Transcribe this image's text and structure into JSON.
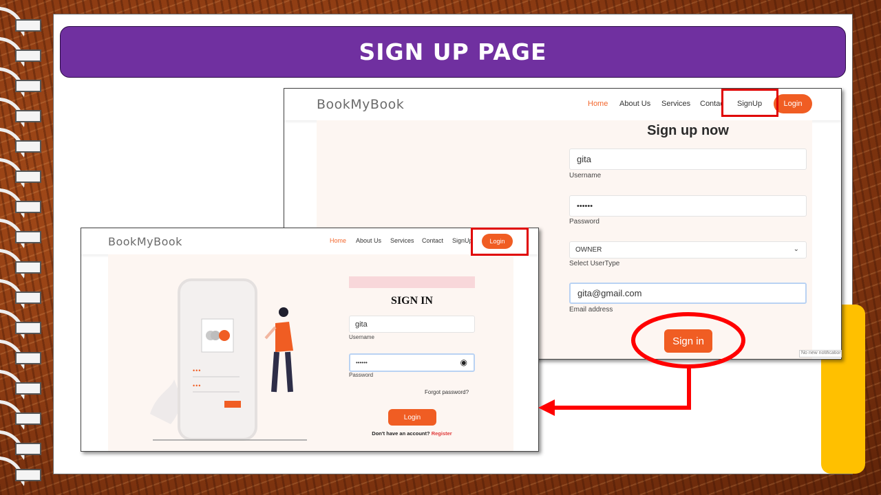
{
  "slide": {
    "title": "SIGN UP PAGE"
  },
  "signup_screen": {
    "brand": "BookMyBook",
    "nav": [
      "Home",
      "About Us",
      "Services",
      "Contact",
      "SignUp"
    ],
    "login_button": "Login",
    "heading": "Sign up now",
    "username_value": "gita",
    "username_label": "Username",
    "password_value": "••••••",
    "password_label": "Password",
    "usertype_value": "OWNER",
    "usertype_label": "Select UserType",
    "email_value": "gita@gmail.com",
    "email_label": "Email address",
    "submit_button": "Sign in",
    "notification": "No new notifications"
  },
  "signin_screen": {
    "brand": "BookMyBook",
    "nav": [
      "Home",
      "About Us",
      "Services",
      "Contact",
      "SignUp"
    ],
    "login_button": "Login",
    "heading": "SIGN IN",
    "username_value": "gita",
    "username_label": "Username",
    "password_value": "••••••",
    "password_label": "Password",
    "forgot": "Forgot password?",
    "submit_button": "Login",
    "register_prompt": "Don't have an account?",
    "register_link": "Register",
    "illustration_dots": "•••"
  },
  "colors": {
    "accent": "#f05d23",
    "banner": "#7030a0",
    "highlight": "#e00000",
    "tab": "#ffc000"
  }
}
